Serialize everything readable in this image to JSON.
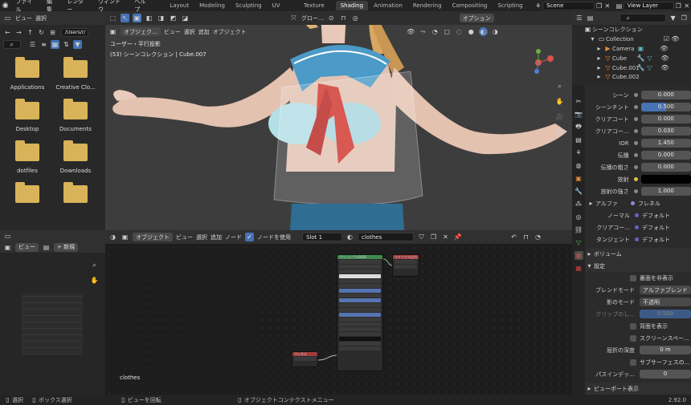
{
  "menubar": {
    "menus": [
      "ファイル",
      "編集",
      "レンダー",
      "ウィンドウ",
      "ヘルプ"
    ],
    "workspaces": [
      "Layout",
      "Modeling",
      "Sculpting",
      "UV Editing",
      "Texture Paint",
      "Shading",
      "Animation",
      "Rendering",
      "Compositing",
      "Scripting"
    ],
    "active_workspace": "Shading",
    "scene": "Scene",
    "view_layer": "View Layer"
  },
  "filebrowser": {
    "menus": [
      "ビュー",
      "選択"
    ],
    "path": "/Users/r/",
    "items": [
      "Applications",
      "Creative Clo...",
      "Desktop",
      "Documents",
      "dotfiles",
      "Downloads"
    ]
  },
  "viewport": {
    "mode": "オブジェク...",
    "menus": [
      "ビュー",
      "選択",
      "追加",
      "オブジェクト"
    ],
    "transform": "グロー...",
    "options": "オプション",
    "info_line1": "ユーザー・平行投影",
    "info_line2": "(53) シーンコレクション | Cube.007"
  },
  "nodeeditor": {
    "mode": "オブジェクト",
    "menus": [
      "ビュー",
      "選択",
      "追加",
      "ノード"
    ],
    "use_nodes_label": "ノードを使用",
    "slot": "Slot 1",
    "material": "clothes",
    "footer_label": "clothes",
    "node_titles": [
      "プリンシプルBSDF",
      "マテリアル出力",
      "フレネル"
    ]
  },
  "imageeditor": {
    "view": "ビュー",
    "new_button": "新規"
  },
  "outliner": {
    "title": "シーンコレクション",
    "items": [
      "Collection",
      "Camera",
      "Cube",
      "Cube.001",
      "Cube.002"
    ]
  },
  "properties": {
    "rows": [
      {
        "label": "シーン",
        "value": "0.000"
      },
      {
        "label": "シーンチント",
        "value": "0.500"
      },
      {
        "label": "クリアコート",
        "value": "0.000"
      },
      {
        "label": "クリアコー...",
        "value": "0.030"
      },
      {
        "label": "IOR",
        "value": "1.450"
      },
      {
        "label": "伝播",
        "value": "0.000"
      },
      {
        "label": "伝播の粗さ",
        "value": "0.000"
      },
      {
        "label": "放射",
        "value": ""
      },
      {
        "label": "放射の強さ",
        "value": "1.000"
      }
    ],
    "alpha_label": "アルファ",
    "alpha_value": "フレネル",
    "normal_label": "ノーマル",
    "normal_value": "デフォルト",
    "clearcoat_normal_label": "クリアコー...",
    "clearcoat_normal_value": "デフォルト",
    "tangent_label": "タンジェント",
    "tangent_value": "デフォルト",
    "volume_header": "ボリューム",
    "settings_header": "設定",
    "backface_culling": "裏面を非表示",
    "blend_mode_label": "ブレンドモード",
    "blend_mode_value": "アルファブレンド",
    "shadow_mode_label": "影のモード",
    "shadow_mode_value": "不透明",
    "clip_label": "クリップのし...",
    "clip_value": "0.500",
    "show_backface": "背面を表示",
    "screen_space": "スクリーンスペー...",
    "refraction_depth_label": "屈折の深度",
    "refraction_depth_value": "0 m",
    "subsurface": "サブサーフェスの...",
    "pass_index_label": "パスインデッ...",
    "pass_index_value": "0",
    "viewport_display_header": "ビューポート表示"
  },
  "statusbar": {
    "select": "選択",
    "box_select": "ボックス選択",
    "rotate_view": "ビューを回転",
    "context_menu": "オブジェクトコンテクストメニュー",
    "version": "2.92.0"
  }
}
